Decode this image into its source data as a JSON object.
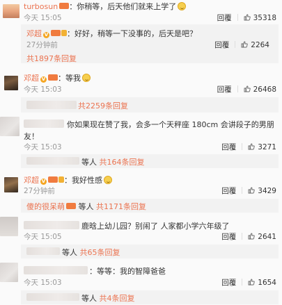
{
  "c1": {
    "name": "turbosun",
    "text": "：你稍等，后天他们就来上学了",
    "time": "今天 15:05",
    "reply": "回覆",
    "likes": "35318"
  },
  "r1": {
    "name": "邓超",
    "text": "：好好，稍等一下没事的，后天是吧？",
    "time": "27分钟前",
    "reply": "回覆",
    "likes": "2264"
  },
  "r1_more": "共1897条回复",
  "c2": {
    "name": "邓超",
    "text": "：等我",
    "time": "今天 15:03",
    "reply": "回覆",
    "likes": "26468"
  },
  "c2_more": "共2259条回复",
  "c3": {
    "text": "你如果现在赞了我，会多一个天秤座 180cm 会讲段子的男朋",
    "text2": "友！",
    "time": "今天 15:03",
    "reply": "回覆",
    "likes": "3271"
  },
  "c3_more": {
    "who": "等人",
    "count": "共164条回复"
  },
  "c4": {
    "name": "邓超",
    "text": "：我好性感",
    "time": "27分钟前",
    "reply": "回覆",
    "likes": "3429"
  },
  "c4_more": {
    "prefix": "傻的很呆萌",
    "who": "等人",
    "count": "共1171条回复"
  },
  "c5": {
    "text": "鹿晗上幼儿园？别闹了 人家都小学六年级了",
    "time": "今天 15:05",
    "reply": "回覆",
    "likes": "2641"
  },
  "c5_more": {
    "who": "等人",
    "count": "共65条回复"
  },
  "c6": {
    "text": "：等等：我的智障爸爸",
    "time": "今天 15:03",
    "reply": "回覆",
    "likes": "1654"
  },
  "c6_more": {
    "who": "等人",
    "count": "共4条回复"
  },
  "colors": {
    "name": "#eb7350",
    "bg": "#fafafa",
    "reply_bg": "#f2f2f2"
  },
  "icons": {
    "like": "thumb-up-icon",
    "verified": "verified-badge-icon",
    "emoji": "smile-emoji-icon"
  }
}
